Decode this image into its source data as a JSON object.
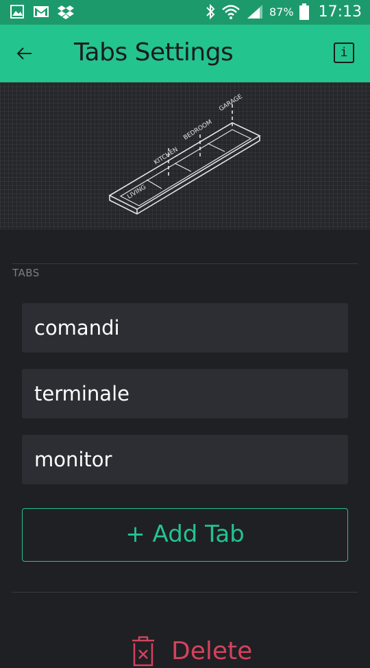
{
  "status_bar": {
    "icons_left": [
      "gallery-icon",
      "gmail-icon",
      "dropbox-icon"
    ],
    "icons_right": [
      "bluetooth-icon",
      "wifi-icon",
      "signal-icon",
      "battery-icon"
    ],
    "battery": "87%",
    "time": "17:13"
  },
  "app_bar": {
    "title": "Tabs Settings",
    "info_label": "i"
  },
  "illustration": {
    "labels": [
      "LIVING",
      "KITCHEN",
      "BEDROOM",
      "GARAGE"
    ]
  },
  "section": {
    "label": "TABS"
  },
  "tabs": [
    {
      "value": "comandi"
    },
    {
      "value": "terminale"
    },
    {
      "value": "monitor"
    }
  ],
  "add_tab_label": "+ Add Tab",
  "delete_label": "Delete",
  "colors": {
    "accent": "#23c48e",
    "status_bar": "#1d9a6c",
    "background": "#1f2024",
    "field": "#2d2e33",
    "danger": "#d3435c"
  }
}
